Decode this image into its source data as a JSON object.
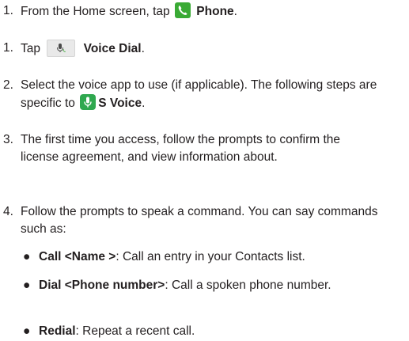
{
  "steps_a": [
    {
      "num": "1.",
      "pre": "From the Home screen, tap",
      "bold": "Phone",
      "post": "."
    }
  ],
  "steps_b": [
    {
      "num": "1.",
      "pre": "Tap",
      "bold": "Voice Dial",
      "post": "."
    },
    {
      "num": "2.",
      "pre": "Select the voice app to use (if applicable). The following steps are specific to",
      "bold": "S Voice",
      "post": "."
    },
    {
      "num": "3.",
      "text": "The first time you access, follow the prompts to confirm the license agreement, and view information about."
    },
    {
      "num": "4.",
      "text": "Follow the prompts to speak a command. You can say commands such as:"
    }
  ],
  "bullets": [
    {
      "bold": "Call <Name >",
      "text": ": Call an entry in your Contacts list."
    },
    {
      "bold": "Dial <Phone number>",
      "text": ": Call a spoken phone number."
    },
    {
      "bold": "Redial",
      "text": ": Repeat a recent call."
    }
  ],
  "icons": {
    "phone": "phone-app-icon",
    "voice_dial": "voice-dial-icon",
    "s_voice": "s-voice-icon"
  },
  "colors": {
    "phone_icon": "#3aaa35",
    "svoice_icon": "#2fa84f",
    "text": "#231f20"
  }
}
